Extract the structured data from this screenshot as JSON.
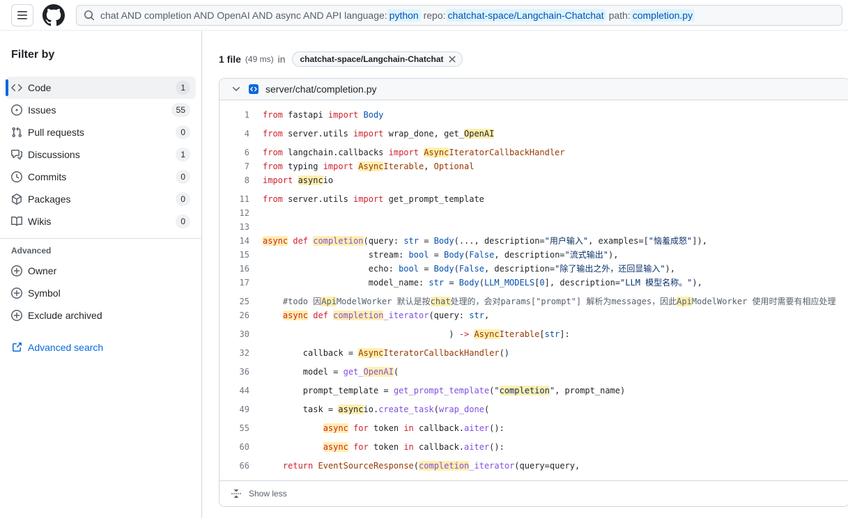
{
  "colors": {
    "accent": "#0969da",
    "match_highlight": "#fff0a3",
    "qualifier_bg": "#ddf4ff",
    "qualifier_text": "#0550ae",
    "border": "#d0d7de",
    "panel_bg": "#f6f8fa",
    "keyword": "#cf222e",
    "constant": "#0550ae",
    "entity": "#8250df",
    "string": "#0a3069",
    "variable": "#953800",
    "comment": "#57606a"
  },
  "header": {
    "menu_icon": "three-bars-icon",
    "logo_icon": "github-logo",
    "search_icon": "search-icon",
    "search": {
      "parts": [
        {
          "text": "chat AND completion AND OpenAI AND async AND API language:",
          "qualifier": false
        },
        {
          "text": "python",
          "qualifier": true
        },
        {
          "text": " repo:",
          "qualifier": false
        },
        {
          "text": "chatchat-space/Langchain-Chatchat",
          "qualifier": true
        },
        {
          "text": " path:",
          "qualifier": false
        },
        {
          "text": "completion.py",
          "qualifier": true
        }
      ]
    }
  },
  "sidebar": {
    "title": "Filter by",
    "items": [
      {
        "label": "Code",
        "count": "1",
        "icon": "code-icon",
        "selected": true
      },
      {
        "label": "Issues",
        "count": "55",
        "icon": "issue-opened-icon",
        "selected": false
      },
      {
        "label": "Pull requests",
        "count": "0",
        "icon": "git-pull-request-icon",
        "selected": false
      },
      {
        "label": "Discussions",
        "count": "1",
        "icon": "comment-discussion-icon",
        "selected": false
      },
      {
        "label": "Commits",
        "count": "0",
        "icon": "history-icon",
        "selected": false
      },
      {
        "label": "Packages",
        "count": "0",
        "icon": "package-icon",
        "selected": false
      },
      {
        "label": "Wikis",
        "count": "0",
        "icon": "book-icon",
        "selected": false
      }
    ],
    "advanced": {
      "title": "Advanced",
      "items": [
        {
          "label": "Owner",
          "icon": "plus-circle-icon"
        },
        {
          "label": "Symbol",
          "icon": "plus-circle-icon"
        },
        {
          "label": "Exclude archived",
          "icon": "plus-circle-icon"
        }
      ],
      "link": {
        "label": "Advanced search",
        "icon": "link-external-icon"
      }
    }
  },
  "results": {
    "count": "1 file",
    "time": "(49 ms)",
    "in_word": "in",
    "chip": "chatchat-space/Langchain-Chatchat"
  },
  "file": {
    "path": "server/chat/completion.py",
    "footer_label": "Show less",
    "lines": [
      {
        "n": "1",
        "g": false,
        "s": [
          [
            "from ",
            "k"
          ],
          [
            "fastapi ",
            "p"
          ],
          [
            "import ",
            "k"
          ],
          [
            "Body",
            "c"
          ]
        ]
      },
      {
        "n": "4",
        "g": true,
        "s": [
          [
            "from ",
            "k"
          ],
          [
            "server.utils ",
            "p"
          ],
          [
            "import ",
            "k"
          ],
          [
            "wrap_done, get_",
            "p"
          ],
          [
            "OpenAI",
            "p",
            true
          ]
        ]
      },
      {
        "n": "6",
        "g": true,
        "s": [
          [
            "from ",
            "k"
          ],
          [
            "langchain.callbacks ",
            "p"
          ],
          [
            "import ",
            "k"
          ],
          [
            "Async",
            "v",
            true
          ],
          [
            "IteratorCallbackHandler",
            "v"
          ]
        ]
      },
      {
        "n": "7",
        "g": false,
        "s": [
          [
            "from ",
            "k"
          ],
          [
            "typing ",
            "p"
          ],
          [
            "import ",
            "k"
          ],
          [
            "Async",
            "v",
            true
          ],
          [
            "Iterable",
            "v"
          ],
          [
            ", ",
            "p"
          ],
          [
            "Optional",
            "v"
          ]
        ]
      },
      {
        "n": "8",
        "g": false,
        "s": [
          [
            "import ",
            "k"
          ],
          [
            "async",
            "p",
            true
          ],
          [
            "io",
            "p"
          ]
        ]
      },
      {
        "n": "11",
        "g": true,
        "s": [
          [
            "from ",
            "k"
          ],
          [
            "server.utils ",
            "p"
          ],
          [
            "import ",
            "k"
          ],
          [
            "get_prompt_template",
            "p"
          ]
        ]
      },
      {
        "n": "12",
        "g": false,
        "s": []
      },
      {
        "n": "13",
        "g": false,
        "s": []
      },
      {
        "n": "14",
        "g": false,
        "s": [
          [
            "async",
            "k",
            true
          ],
          [
            " ",
            "p"
          ],
          [
            "def ",
            "k"
          ],
          [
            "completion",
            "e",
            true
          ],
          [
            "(query: ",
            "p"
          ],
          [
            "str",
            "c"
          ],
          [
            " = ",
            "p"
          ],
          [
            "Body",
            "c"
          ],
          [
            "(..., description=",
            "p"
          ],
          [
            "\"用户输入\"",
            "s"
          ],
          [
            ", examples=[",
            "p"
          ],
          [
            "\"恼羞成怒\"",
            "s"
          ],
          [
            "]),",
            "p"
          ]
        ]
      },
      {
        "n": "15",
        "g": false,
        "s": [
          [
            "                     stream: ",
            "p"
          ],
          [
            "bool",
            "c"
          ],
          [
            " = ",
            "p"
          ],
          [
            "Body",
            "c"
          ],
          [
            "(",
            "p"
          ],
          [
            "False",
            "c"
          ],
          [
            ", description=",
            "p"
          ],
          [
            "\"流式输出\"",
            "s"
          ],
          [
            "),",
            "p"
          ]
        ]
      },
      {
        "n": "16",
        "g": false,
        "s": [
          [
            "                     echo: ",
            "p"
          ],
          [
            "bool",
            "c"
          ],
          [
            " = ",
            "p"
          ],
          [
            "Body",
            "c"
          ],
          [
            "(",
            "p"
          ],
          [
            "False",
            "c"
          ],
          [
            ", description=",
            "p"
          ],
          [
            "\"除了输出之外，还回显输入\"",
            "s"
          ],
          [
            "),",
            "p"
          ]
        ]
      },
      {
        "n": "17",
        "g": false,
        "s": [
          [
            "                     model_name: ",
            "p"
          ],
          [
            "str",
            "c"
          ],
          [
            " = ",
            "p"
          ],
          [
            "Body",
            "c"
          ],
          [
            "(",
            "p"
          ],
          [
            "LLM_MODELS",
            "c"
          ],
          [
            "[",
            "p"
          ],
          [
            "0",
            "c"
          ],
          [
            "], description=",
            "p"
          ],
          [
            "\"LLM 模型名称。\"",
            "s"
          ],
          [
            "),",
            "p"
          ]
        ]
      },
      {
        "n": "25",
        "g": true,
        "s": [
          [
            "    #todo 因",
            "m"
          ],
          [
            "Api",
            "m",
            true
          ],
          [
            "ModelWorker 默认是按",
            "m"
          ],
          [
            "chat",
            "m",
            true
          ],
          [
            "处理的，会对params[\"prompt\"] 解析为messages，因此",
            "m"
          ],
          [
            "Api",
            "m",
            true
          ],
          [
            "ModelWorker 使用时需要有相应处理",
            "m"
          ]
        ]
      },
      {
        "n": "26",
        "g": false,
        "s": [
          [
            "    ",
            "p"
          ],
          [
            "async",
            "k",
            true
          ],
          [
            " ",
            "p"
          ],
          [
            "def ",
            "k"
          ],
          [
            "completion",
            "e",
            true
          ],
          [
            "_iterator",
            "e"
          ],
          [
            "(query: ",
            "p"
          ],
          [
            "str",
            "c"
          ],
          [
            ",",
            "p"
          ]
        ]
      },
      {
        "n": "30",
        "g": true,
        "s": [
          [
            "                                     ) ",
            "p"
          ],
          [
            "->",
            "k"
          ],
          [
            " ",
            "p"
          ],
          [
            "Async",
            "v",
            true
          ],
          [
            "Iterable",
            "v"
          ],
          [
            "[",
            "p"
          ],
          [
            "str",
            "c"
          ],
          [
            "]:",
            "p"
          ]
        ]
      },
      {
        "n": "32",
        "g": true,
        "s": [
          [
            "        callback = ",
            "p"
          ],
          [
            "Async",
            "v",
            true
          ],
          [
            "IteratorCallbackHandler",
            "v"
          ],
          [
            "()",
            "p"
          ]
        ]
      },
      {
        "n": "36",
        "g": true,
        "s": [
          [
            "        model = ",
            "p"
          ],
          [
            "get_",
            "e"
          ],
          [
            "OpenAI",
            "e",
            true
          ],
          [
            "(",
            "p"
          ]
        ]
      },
      {
        "n": "44",
        "g": true,
        "s": [
          [
            "        prompt_template = ",
            "p"
          ],
          [
            "get_prompt_template",
            "e"
          ],
          [
            "(",
            "p"
          ],
          [
            "\"",
            "s"
          ],
          [
            "completion",
            "s",
            true
          ],
          [
            "\"",
            "s"
          ],
          [
            ", prompt_name)",
            "p"
          ]
        ]
      },
      {
        "n": "49",
        "g": true,
        "s": [
          [
            "        task = ",
            "p"
          ],
          [
            "async",
            "p",
            true
          ],
          [
            "io.",
            "p"
          ],
          [
            "create_task",
            "e"
          ],
          [
            "(",
            "p"
          ],
          [
            "wrap_done",
            "e"
          ],
          [
            "(",
            "p"
          ]
        ]
      },
      {
        "n": "55",
        "g": true,
        "s": [
          [
            "            ",
            "p"
          ],
          [
            "async",
            "k",
            true
          ],
          [
            " ",
            "p"
          ],
          [
            "for",
            "k"
          ],
          [
            " token ",
            "p"
          ],
          [
            "in",
            "k"
          ],
          [
            " callback.",
            "p"
          ],
          [
            "aiter",
            "e"
          ],
          [
            "():",
            "p"
          ]
        ]
      },
      {
        "n": "60",
        "g": true,
        "s": [
          [
            "            ",
            "p"
          ],
          [
            "async",
            "k",
            true
          ],
          [
            " ",
            "p"
          ],
          [
            "for",
            "k"
          ],
          [
            " token ",
            "p"
          ],
          [
            "in",
            "k"
          ],
          [
            " callback.",
            "p"
          ],
          [
            "aiter",
            "e"
          ],
          [
            "():",
            "p"
          ]
        ]
      },
      {
        "n": "66",
        "g": true,
        "s": [
          [
            "    ",
            "p"
          ],
          [
            "return",
            "k"
          ],
          [
            " ",
            "p"
          ],
          [
            "EventSourceResponse",
            "v"
          ],
          [
            "(",
            "p"
          ],
          [
            "completion",
            "e",
            true
          ],
          [
            "_iterator",
            "e"
          ],
          [
            "(query=query,",
            "p"
          ]
        ]
      }
    ]
  }
}
